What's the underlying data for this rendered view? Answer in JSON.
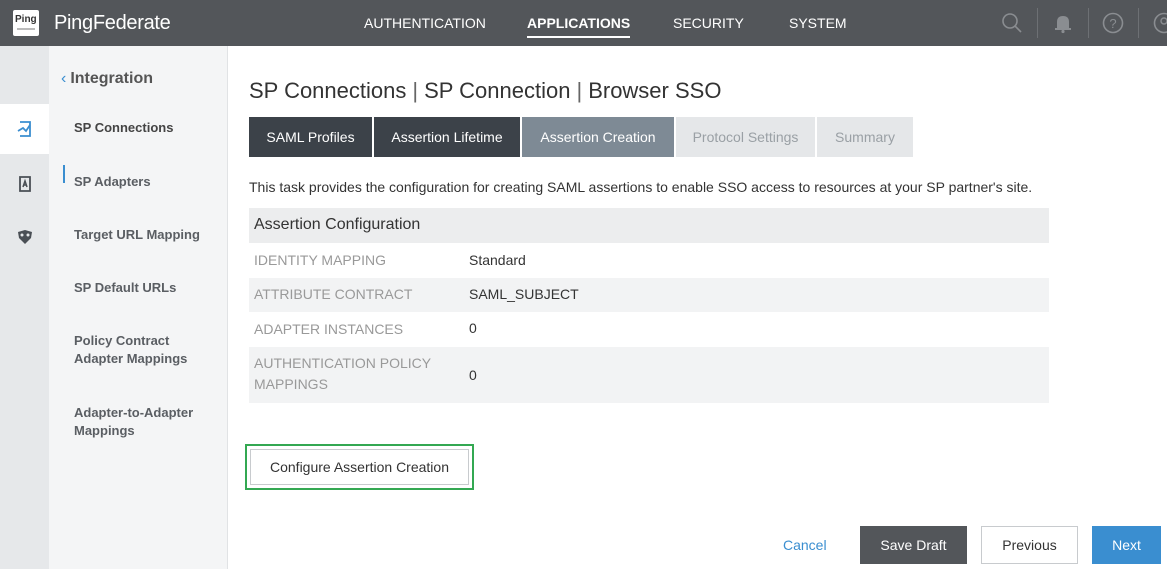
{
  "app": {
    "logo_text": "Ping",
    "brand": "PingFederate"
  },
  "nav": {
    "items": [
      {
        "label": "AUTHENTICATION",
        "active": false
      },
      {
        "label": "APPLICATIONS",
        "active": true
      },
      {
        "label": "SECURITY",
        "active": false
      },
      {
        "label": "SYSTEM",
        "active": false
      }
    ],
    "icons": [
      "search-icon",
      "bell-icon",
      "help-icon",
      "user-icon"
    ]
  },
  "rail": {
    "icons": [
      "connections-icon",
      "adapters-icon",
      "oauth-icon"
    ]
  },
  "sidebar": {
    "back_label": "Integration",
    "items": [
      {
        "label": "SP Connections",
        "active": true
      },
      {
        "label": "SP Adapters"
      },
      {
        "label": "Target URL Mapping"
      },
      {
        "label": "SP Default URLs"
      },
      {
        "label": "Policy Contract Adapter Mappings"
      },
      {
        "label": "Adapter-to-Adapter Mappings"
      }
    ]
  },
  "breadcrumb": [
    "SP Connections",
    "SP Connection",
    "Browser SSO"
  ],
  "tabs": [
    {
      "label": "SAML Profiles",
      "state": "done"
    },
    {
      "label": "Assertion Lifetime",
      "state": "done"
    },
    {
      "label": "Assertion Creation",
      "state": "current"
    },
    {
      "label": "Protocol Settings",
      "state": "todo"
    },
    {
      "label": "Summary",
      "state": "todo"
    }
  ],
  "description": "This task provides the configuration for creating SAML assertions to enable SSO access to resources at your SP partner's site.",
  "assertion_config": {
    "title": "Assertion Configuration",
    "rows": [
      {
        "key": "IDENTITY MAPPING",
        "value": "Standard"
      },
      {
        "key": "ATTRIBUTE CONTRACT",
        "value": "SAML_SUBJECT"
      },
      {
        "key": "ADAPTER INSTANCES",
        "value": "0"
      },
      {
        "key": "AUTHENTICATION POLICY MAPPINGS",
        "value": "0"
      }
    ]
  },
  "configure_button": "Configure Assertion Creation",
  "footer": {
    "cancel": "Cancel",
    "save_draft": "Save Draft",
    "previous": "Previous",
    "next": "Next"
  },
  "colors": {
    "topbar": "#53565a",
    "accent": "#3a8ed0",
    "tab_done": "#3c4249",
    "tab_current": "#7e8a95",
    "tab_todo": "#e5e7e9",
    "highlight": "#33a852"
  }
}
